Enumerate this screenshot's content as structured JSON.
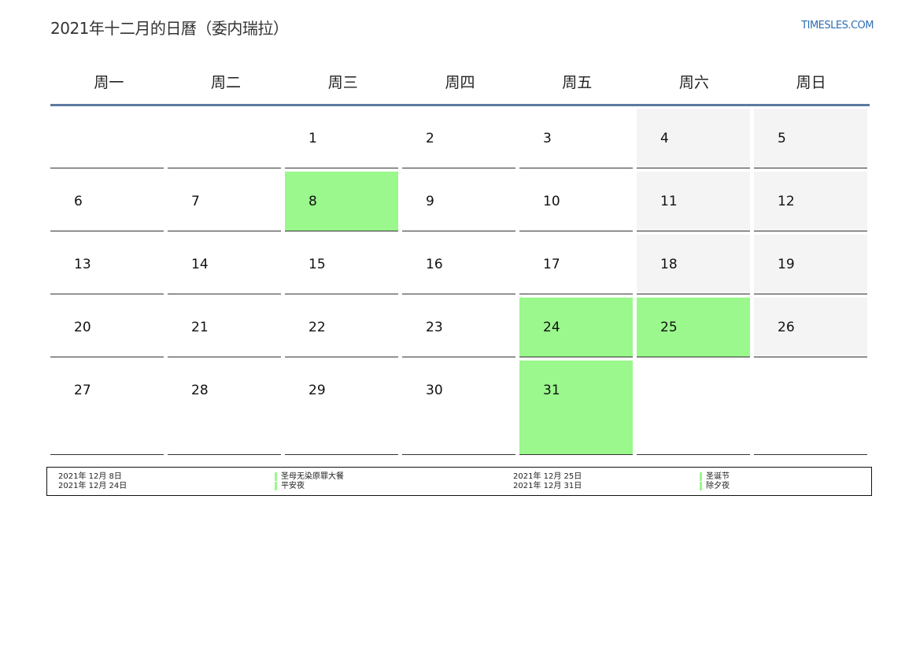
{
  "header": {
    "title": "2021年十二月的日曆（委内瑞拉）",
    "brand": "TIMESLES.COM"
  },
  "weekdays": [
    "周一",
    "周二",
    "周三",
    "周四",
    "周五",
    "周六",
    "周日"
  ],
  "weeks": [
    [
      null,
      null,
      1,
      2,
      3,
      4,
      5
    ],
    [
      6,
      7,
      8,
      9,
      10,
      11,
      12
    ],
    [
      13,
      14,
      15,
      16,
      17,
      18,
      19
    ],
    [
      20,
      21,
      22,
      23,
      24,
      25,
      26
    ],
    [
      27,
      28,
      29,
      30,
      31,
      null,
      null
    ]
  ],
  "holiday_days": [
    8,
    24,
    25,
    31
  ],
  "colors": {
    "holiday": "#9af88c",
    "weekend": "#f4f4f4",
    "header_rule": "#5b7aa0",
    "brand": "#2f6eb5"
  },
  "legend": [
    {
      "date": "2021年 12月 8日",
      "name": "圣母无染原罪大餐"
    },
    {
      "date": "2021年 12月 24日",
      "name": "平安夜"
    },
    {
      "date": "2021年 12月 25日",
      "name": "圣诞节"
    },
    {
      "date": "2021年 12月 31日",
      "name": "除夕夜"
    }
  ]
}
